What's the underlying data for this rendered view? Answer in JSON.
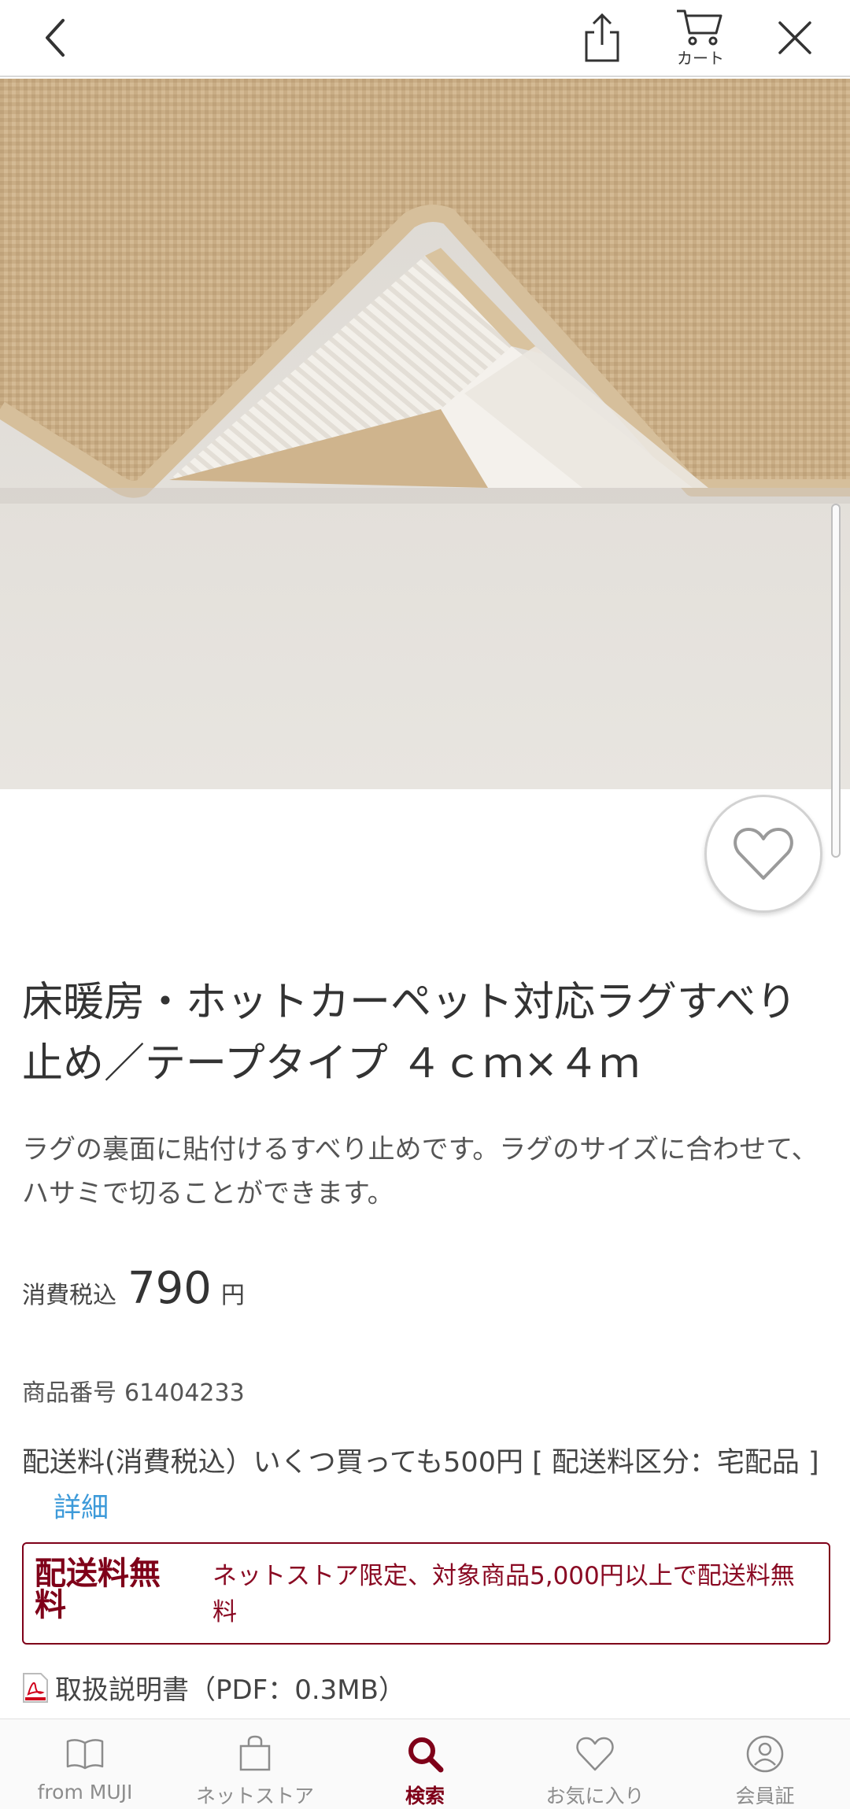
{
  "header": {
    "cart_label": "カート"
  },
  "product": {
    "title": "床暖房・ホットカーペット対応ラグすべり止め／テープタイプ ４ｃｍ×４ｍ",
    "description": "ラグの裏面に貼付けるすべり止めです。ラグのサイズに合わせて、ハサミで切ることができます。",
    "price_label": "消費税込",
    "price_value": "790",
    "price_unit": "円",
    "sku_label": "商品番号",
    "sku_value": "61404233",
    "shipping_text": "配送料(消費税込）いくつ買っても500円 [ 配送料区分：宅配品 ]",
    "shipping_detail_link": "詳細",
    "free_shipping_title": "配送料無料",
    "free_shipping_text": "ネットストア限定、対象商品5,000円以上で配送料無料",
    "manual_text": "取扱説明書（PDF：0.3MB）"
  },
  "bottom_nav": {
    "items": [
      {
        "label": "from MUJI",
        "icon": "book-icon"
      },
      {
        "label": "ネットストア",
        "icon": "shopping-bag-icon"
      },
      {
        "label": "検索",
        "icon": "search-icon",
        "active": true
      },
      {
        "label": "お気に入り",
        "icon": "heart-icon"
      },
      {
        "label": "会員証",
        "icon": "member-card-icon"
      }
    ]
  },
  "colors": {
    "accent": "#7f0019",
    "link": "#3d9ad9",
    "rug": "#c9ad85",
    "backdrop": "#e6e3de"
  }
}
